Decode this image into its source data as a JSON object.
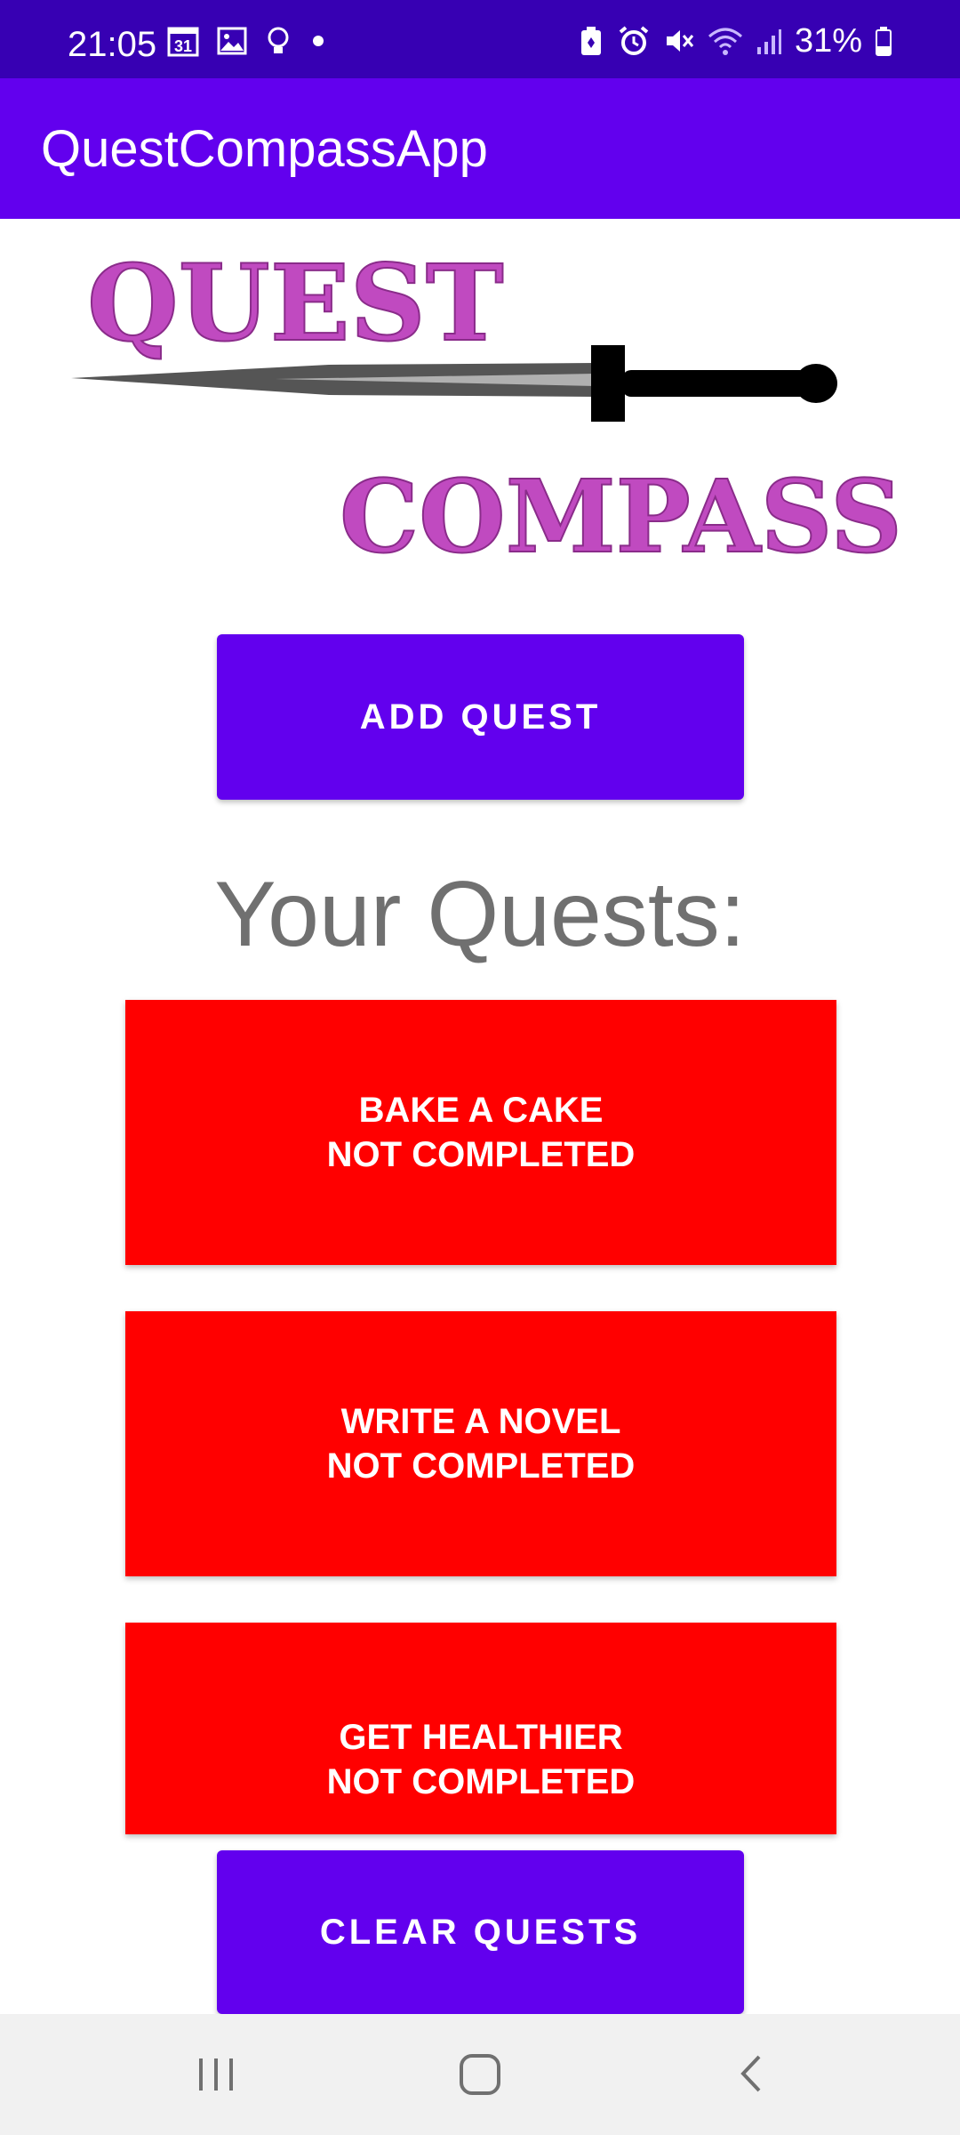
{
  "status_bar": {
    "time": "21:05",
    "calendar_day": "31",
    "battery_percent": "31%",
    "left_icons": [
      "calendar-icon",
      "gallery-icon",
      "bulb-icon",
      "dot-icon"
    ],
    "right_icons": [
      "battery-saver-icon",
      "alarm-icon",
      "mute-icon",
      "wifi-icon",
      "signal-icon",
      "battery-icon"
    ]
  },
  "app_bar": {
    "title": "QuestCompassApp"
  },
  "logo": {
    "line1": "QUEST",
    "line2": "COMPASS"
  },
  "add_button": {
    "label": "ADD QUEST"
  },
  "quests_section": {
    "title": "Your Quests:"
  },
  "quests": [
    {
      "name": "BAKE A CAKE",
      "status": "NOT COMPLETED"
    },
    {
      "name": "WRITE A NOVEL",
      "status": "NOT COMPLETED"
    },
    {
      "name": "GET HEALTHIER",
      "status": "NOT COMPLETED"
    }
  ],
  "clear_button": {
    "label": "CLEAR QUESTS"
  },
  "colors": {
    "status_bar": "#3700b3",
    "primary": "#6200ee",
    "quest_card": "#ff0000",
    "logo_text": "#c04ac0"
  },
  "nav_bar": {
    "icons": [
      "recent-apps-icon",
      "home-icon",
      "back-icon"
    ]
  }
}
